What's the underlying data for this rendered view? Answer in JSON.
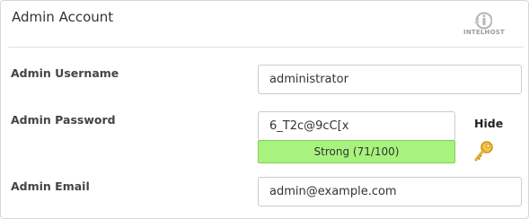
{
  "panel": {
    "title": "Admin Account",
    "logo_text": "INTELHOST"
  },
  "form": {
    "username": {
      "label": "Admin Username",
      "value": "administrator"
    },
    "password": {
      "label": "Admin Password",
      "value": "6_T2c@9cC[x",
      "strength_text": "Strong (71/100)",
      "strength_color": "#a8f37e",
      "hide_label": "Hide",
      "generate_icon": "key-icon"
    },
    "email": {
      "label": "Admin Email",
      "value": "admin@example.com"
    }
  }
}
